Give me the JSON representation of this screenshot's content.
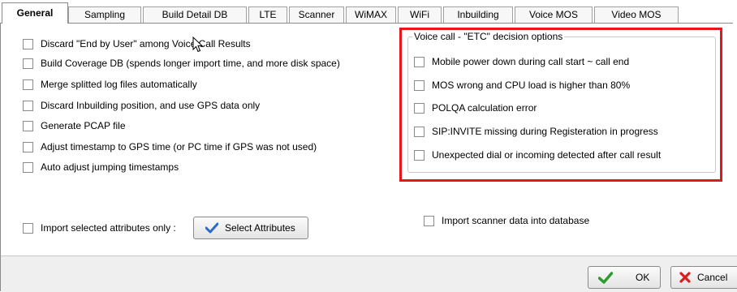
{
  "tabs": [
    {
      "label": "General",
      "active": true
    },
    {
      "label": "Sampling"
    },
    {
      "label": "Build Detail DB"
    },
    {
      "label": "LTE"
    },
    {
      "label": "Scanner"
    },
    {
      "label": "WiMAX"
    },
    {
      "label": "WiFi"
    },
    {
      "label": "Inbuilding"
    },
    {
      "label": "Voice MOS"
    },
    {
      "label": "Video MOS"
    }
  ],
  "left_options": [
    {
      "label": "Discard \"End by User\" among Voice Call Results",
      "checked": false
    },
    {
      "label": "Build Coverage DB (spends longer import time, and more disk space)",
      "checked": false
    },
    {
      "label": "Merge splitted log files automatically",
      "checked": false
    },
    {
      "label": "Discard Inbuilding position, and use GPS data only",
      "checked": false
    },
    {
      "label": "Generate PCAP file",
      "checked": false
    },
    {
      "label": "Adjust timestamp to GPS time (or PC time if GPS was not used)",
      "checked": false
    },
    {
      "label": "Auto adjust jumping timestamps",
      "checked": false
    }
  ],
  "etc_group": {
    "title": "Voice call - \"ETC\" decision options",
    "options": [
      {
        "label": "Mobile power down during call start ~ call end",
        "checked": false
      },
      {
        "label": "MOS wrong and CPU load is higher than 80%",
        "checked": false
      },
      {
        "label": "POLQA calculation error",
        "checked": false
      },
      {
        "label": "SIP:INVITE missing during Registeration in progress",
        "checked": false
      },
      {
        "label": "Unexpected dial or incoming detected after call result",
        "checked": false
      }
    ]
  },
  "import_selected": {
    "label": "Import selected attributes only :",
    "checked": false
  },
  "select_attributes_button": "Select Attributes",
  "import_scanner": {
    "label": "Import scanner data into database",
    "checked": false
  },
  "ok_button": "OK",
  "cancel_button": "Cancel",
  "colors": {
    "highlight": "#e8151b",
    "check_green": "#2e9b2e",
    "cancel_red": "#d81e1e",
    "select_blue": "#2a6bc9"
  }
}
